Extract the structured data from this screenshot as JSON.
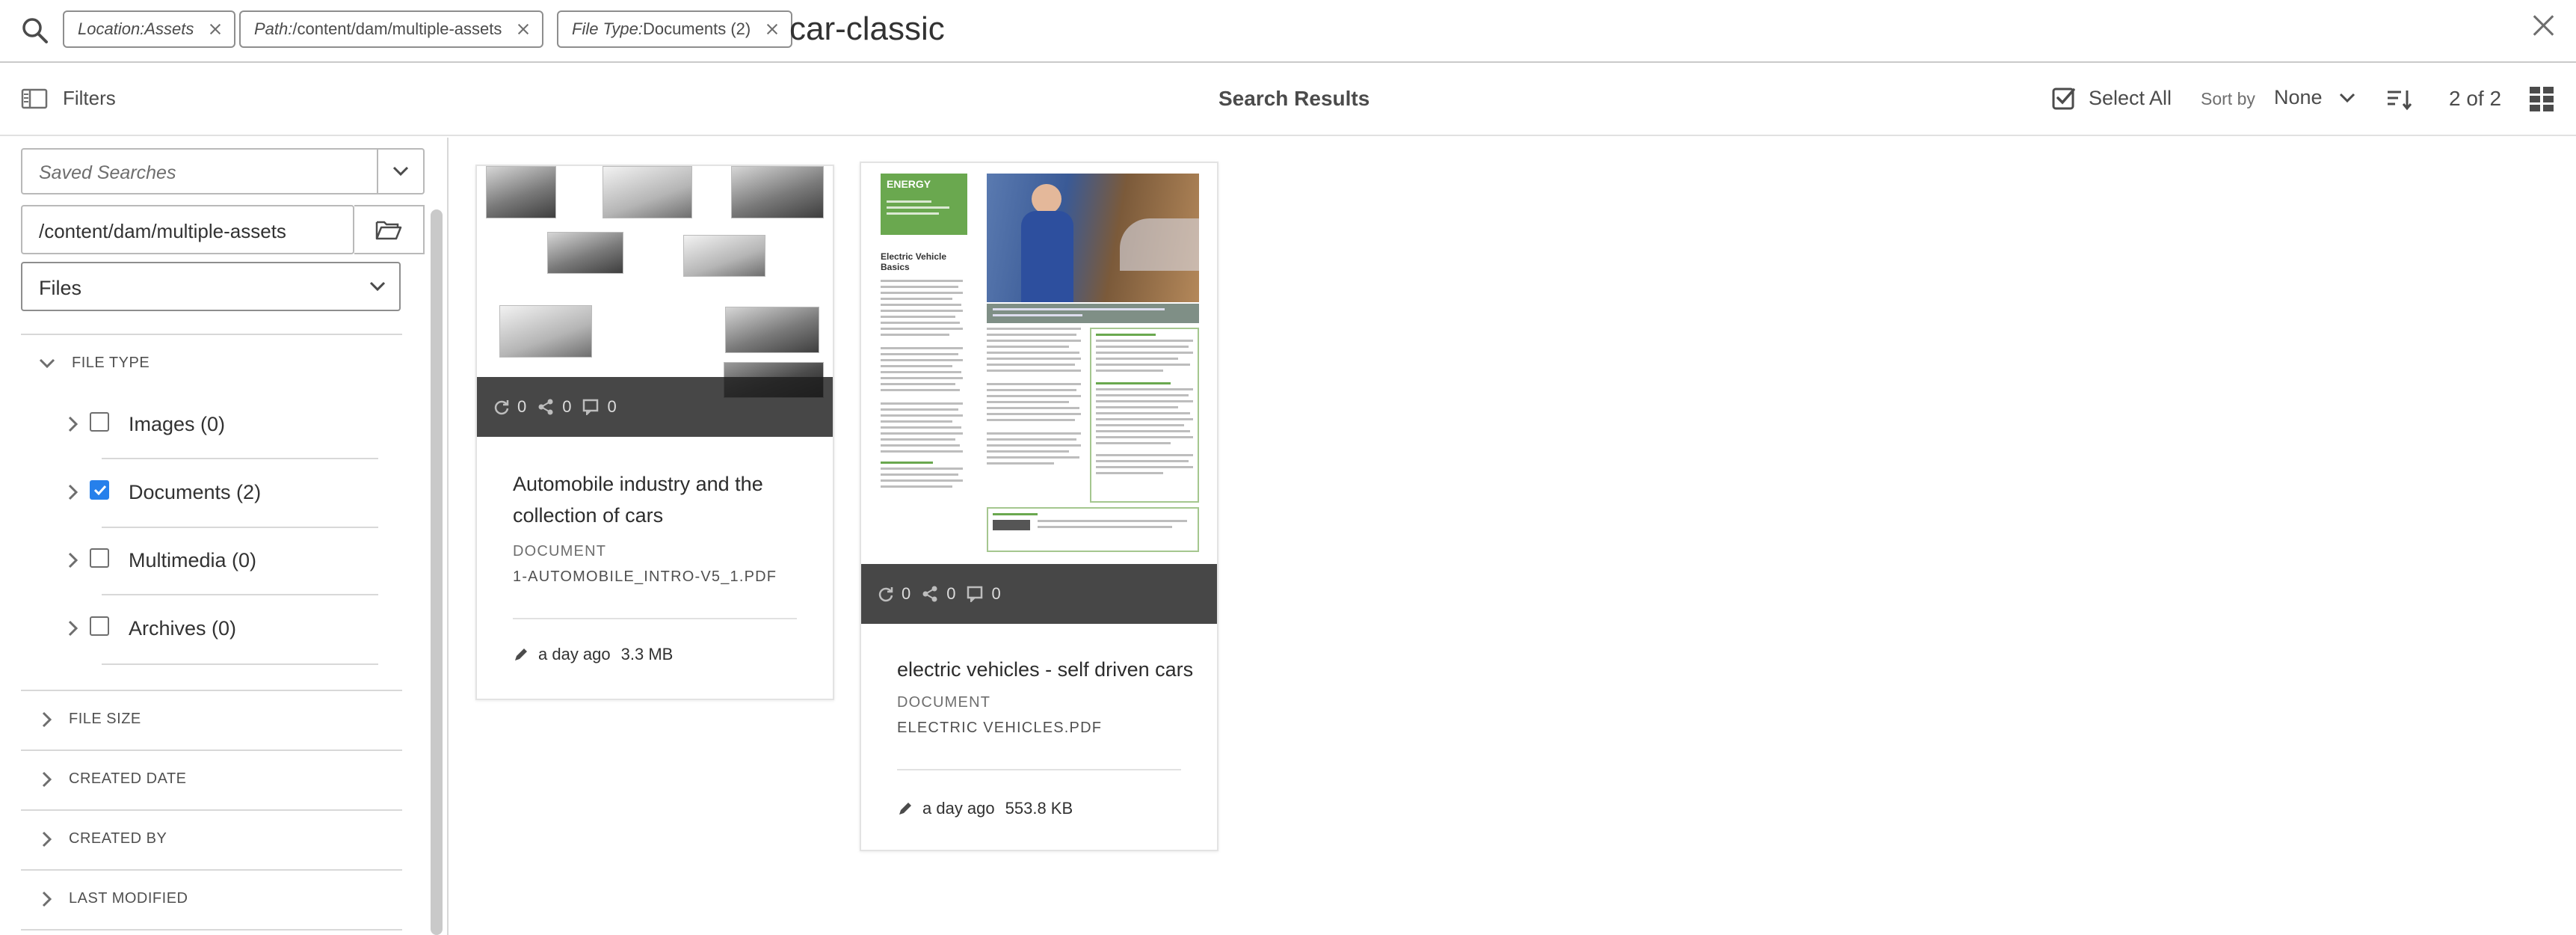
{
  "search": {
    "tags": [
      {
        "label": "Location:",
        "value": " Assets"
      },
      {
        "label": "Path:",
        "value": "/content/dam/multiple-assets"
      },
      {
        "label": "File Type:",
        "value": "Documents (2)"
      }
    ],
    "query": "car-classic"
  },
  "actionbar": {
    "filters_label": "Filters",
    "title": "Search Results",
    "select_all_label": "Select All",
    "sort_by_label": "Sort by",
    "sort_value": "None",
    "count": "2 of 2"
  },
  "rail": {
    "saved_searches_placeholder": "Saved Searches",
    "path_value": "/content/dam/multiple-assets",
    "files_select_value": "Files",
    "file_type_heading": "FILE TYPE",
    "file_types": [
      {
        "label": "Images (0)",
        "checked": false
      },
      {
        "label": "Documents (2)",
        "checked": true
      },
      {
        "label": "Multimedia (0)",
        "checked": false
      },
      {
        "label": "Archives (0)",
        "checked": false
      }
    ],
    "sections": [
      "FILE SIZE",
      "CREATED DATE",
      "CREATED BY",
      "LAST MODIFIED"
    ]
  },
  "cards": [
    {
      "title": "Automobile industry and the collection of cars",
      "type": "DOCUMENT",
      "filename": "1-AUTOMOBILE_INTRO-V5_1.PDF",
      "modified": "a day ago",
      "size": "3.3 MB",
      "stats": [
        "0",
        "0",
        "0"
      ]
    },
    {
      "title": "electric vehicles - self driven cars",
      "type": "DOCUMENT",
      "filename": "ELECTRIC VEHICLES.PDF",
      "modified": "a day ago",
      "size": "553.8 KB",
      "stats": [
        "0",
        "0",
        "0"
      ]
    }
  ],
  "doc_thumb": {
    "banner_title": "ENERGY",
    "heading": "Electric Vehicle Basics"
  },
  "colors": {
    "accent": "#2680eb",
    "doc_green": "#6aa84f"
  }
}
